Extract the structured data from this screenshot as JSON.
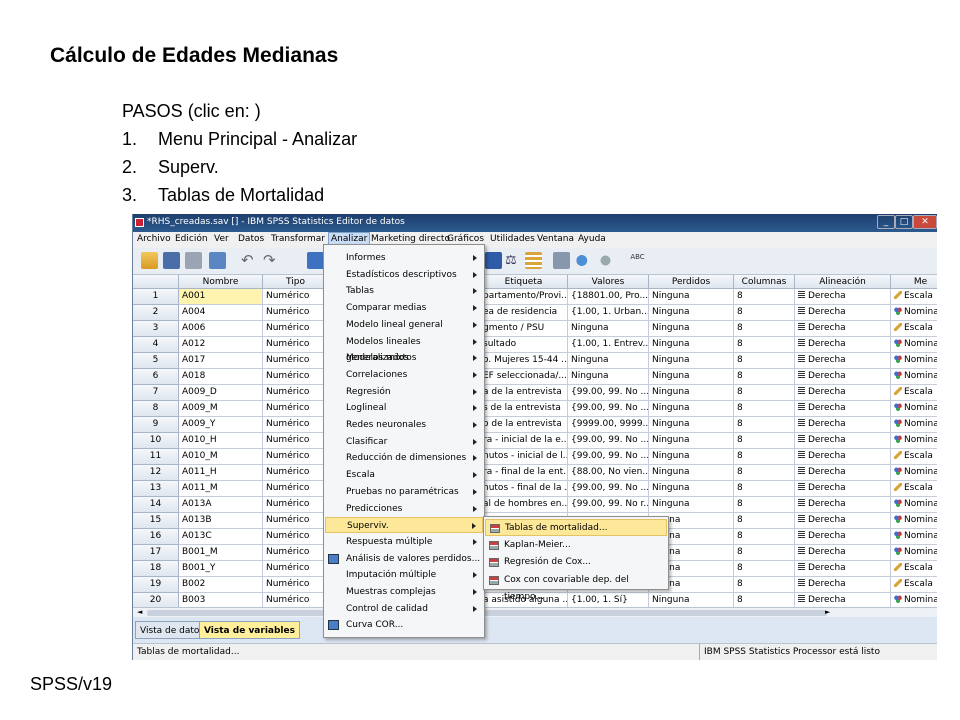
{
  "slide": {
    "title": "Cálculo de Edades Medianas",
    "steps_intro": "PASOS (clic en: )",
    "steps": [
      {
        "num": "1.",
        "text": "Menu Principal - Analizar"
      },
      {
        "num": "2.",
        "text": "Superv."
      },
      {
        "num": "3.",
        "text": "Tablas de Mortalidad"
      }
    ],
    "footer": "SPSS/v19"
  },
  "window": {
    "title": "*RHS_creadas.sav [] - IBM SPSS Statistics Editor de datos",
    "menubar": [
      "Archivo",
      "Edición",
      "Ver",
      "Datos",
      "Transformar",
      "Analizar",
      "Marketing directo",
      "Gráficos",
      "Utilidades",
      "Ventana",
      "Ayuda"
    ]
  },
  "grid": {
    "headers": [
      "Nombre",
      "Tipo",
      "Etiqueta",
      "Valores",
      "Perdidos",
      "Columnas",
      "Alineación",
      "Me"
    ],
    "rows": [
      {
        "n": "1",
        "nombre": "A001",
        "tipo": "Numérico",
        "etiqueta": "partamento/Provi...",
        "valores": "{18801.00, Pro...",
        "perdidos": "Ninguna",
        "columnas": "8",
        "alineacion": "Derecha",
        "medida": "Escala"
      },
      {
        "n": "2",
        "nombre": "A004",
        "tipo": "Numérico",
        "etiqueta": "ea de residencia",
        "valores": "{1.00, 1. Urban...",
        "perdidos": "Ninguna",
        "columnas": "8",
        "alineacion": "Derecha",
        "medida": "Nomina"
      },
      {
        "n": "3",
        "nombre": "A006",
        "tipo": "Numérico",
        "etiqueta": "gmento / PSU",
        "valores": "Ninguna",
        "perdidos": "Ninguna",
        "columnas": "8",
        "alineacion": "Derecha",
        "medida": "Escala"
      },
      {
        "n": "4",
        "nombre": "A012",
        "tipo": "Numérico",
        "etiqueta": "sultado",
        "valores": "{1.00, 1. Entrev...",
        "perdidos": "Ninguna",
        "columnas": "8",
        "alineacion": "Derecha",
        "medida": "Nomina"
      },
      {
        "n": "5",
        "nombre": "A017",
        "tipo": "Numérico",
        "etiqueta": "o. Mujeres 15-44 ...",
        "valores": "Ninguna",
        "perdidos": "Ninguna",
        "columnas": "8",
        "alineacion": "Derecha",
        "medida": "Nomina"
      },
      {
        "n": "6",
        "nombre": "A018",
        "tipo": "Numérico",
        "etiqueta": "EF seleccionada/...",
        "valores": "Ninguna",
        "perdidos": "Ninguna",
        "columnas": "8",
        "alineacion": "Derecha",
        "medida": "Nomina"
      },
      {
        "n": "7",
        "nombre": "A009_D",
        "tipo": "Numérico",
        "etiqueta": "a de la entrevista",
        "valores": "{99.00, 99. No ...",
        "perdidos": "Ninguna",
        "columnas": "8",
        "alineacion": "Derecha",
        "medida": "Escala"
      },
      {
        "n": "8",
        "nombre": "A009_M",
        "tipo": "Numérico",
        "etiqueta": "s de la entrevista",
        "valores": "{99.00, 99. No ...",
        "perdidos": "Ninguna",
        "columnas": "8",
        "alineacion": "Derecha",
        "medida": "Nomina"
      },
      {
        "n": "9",
        "nombre": "A009_Y",
        "tipo": "Numérico",
        "etiqueta": "o de la entrevista",
        "valores": "{9999.00, 9999....",
        "perdidos": "Ninguna",
        "columnas": "8",
        "alineacion": "Derecha",
        "medida": "Nomina"
      },
      {
        "n": "10",
        "nombre": "A010_H",
        "tipo": "Numérico",
        "etiqueta": "ra - inicial de la e...",
        "valores": "{99.00, 99. No ...",
        "perdidos": "Ninguna",
        "columnas": "8",
        "alineacion": "Derecha",
        "medida": "Nomina"
      },
      {
        "n": "11",
        "nombre": "A010_M",
        "tipo": "Numérico",
        "etiqueta": "nutos - inicial de l...",
        "valores": "{99.00, 99. No ...",
        "perdidos": "Ninguna",
        "columnas": "8",
        "alineacion": "Derecha",
        "medida": "Escala"
      },
      {
        "n": "12",
        "nombre": "A011_H",
        "tipo": "Numérico",
        "etiqueta": "ra - final de la ent...",
        "valores": "{88.00, No vien...",
        "perdidos": "Ninguna",
        "columnas": "8",
        "alineacion": "Derecha",
        "medida": "Nomina"
      },
      {
        "n": "13",
        "nombre": "A011_M",
        "tipo": "Numérico",
        "etiqueta": "nutos - final de la ...",
        "valores": "{99.00, 99. No ...",
        "perdidos": "Ninguna",
        "columnas": "8",
        "alineacion": "Derecha",
        "medida": "Escala"
      },
      {
        "n": "14",
        "nombre": "A013A",
        "tipo": "Numérico",
        "etiqueta": "al de hombres en...",
        "valores": "{99.00, 99. No r...",
        "perdidos": "Ninguna",
        "columnas": "8",
        "alineacion": "Derecha",
        "medida": "Nomina"
      },
      {
        "n": "15",
        "nombre": "A013B",
        "tipo": "Numérico",
        "etiqueta": "",
        "valores": "",
        "perdidos": "nguna",
        "columnas": "8",
        "alineacion": "Derecha",
        "medida": "Nomina"
      },
      {
        "n": "16",
        "nombre": "A013C",
        "tipo": "Numérico",
        "etiqueta": "",
        "valores": "",
        "perdidos": "nguna",
        "columnas": "8",
        "alineacion": "Derecha",
        "medida": "Nomina"
      },
      {
        "n": "17",
        "nombre": "B001_M",
        "tipo": "Numérico",
        "etiqueta": "",
        "valores": "",
        "perdidos": "nguna",
        "columnas": "8",
        "alineacion": "Derecha",
        "medida": "Nomina"
      },
      {
        "n": "18",
        "nombre": "B001_Y",
        "tipo": "Numérico",
        "etiqueta": "",
        "valores": "",
        "perdidos": "nguna",
        "columnas": "8",
        "alineacion": "Derecha",
        "medida": "Escala"
      },
      {
        "n": "19",
        "nombre": "B002",
        "tipo": "Numérico",
        "etiqueta": "",
        "valores": "",
        "perdidos": "nguna",
        "columnas": "8",
        "alineacion": "Derecha",
        "medida": "Escala"
      },
      {
        "n": "20",
        "nombre": "B003",
        "tipo": "Numérico",
        "etiqueta": "a asistido alguna ...",
        "valores": "{1.00, 1. Sí}",
        "perdidos": "Ninguna",
        "columnas": "8",
        "alineacion": "Derecha",
        "medida": "Nomina"
      }
    ]
  },
  "tabs": [
    "Vista de datos",
    "Vista de variables"
  ],
  "status": {
    "left": "Tablas de mortalidad...",
    "right": "IBM SPSS Statistics Processor está listo"
  },
  "analizar_menu": [
    {
      "label": "Informes",
      "sub": true
    },
    {
      "label": "Estadísticos descriptivos",
      "sub": true
    },
    {
      "label": "Tablas",
      "sub": true
    },
    {
      "label": "Comparar medias",
      "sub": true
    },
    {
      "label": "Modelo lineal general",
      "sub": true
    },
    {
      "label": "Modelos lineales generalizados",
      "sub": true
    },
    {
      "label": "Modelos mixtos",
      "sub": true
    },
    {
      "label": "Correlaciones",
      "sub": true
    },
    {
      "label": "Regresión",
      "sub": true
    },
    {
      "label": "Loglineal",
      "sub": true
    },
    {
      "label": "Redes neuronales",
      "sub": true
    },
    {
      "label": "Clasificar",
      "sub": true
    },
    {
      "label": "Reducción de dimensiones",
      "sub": true
    },
    {
      "label": "Escala",
      "sub": true
    },
    {
      "label": "Pruebas no paramétricas",
      "sub": true
    },
    {
      "label": "Predicciones",
      "sub": true
    },
    {
      "label": "Superviv.",
      "sub": true,
      "highlight": true
    },
    {
      "label": "Respuesta múltiple",
      "sub": true
    },
    {
      "label": "Análisis de valores perdidos...",
      "sub": false,
      "icon": "missing-values-icon"
    },
    {
      "label": "Imputación múltiple",
      "sub": true
    },
    {
      "label": "Muestras complejas",
      "sub": true
    },
    {
      "label": "Control de calidad",
      "sub": true
    },
    {
      "label": "Curva COR...",
      "sub": false,
      "icon": "roc-curve-icon"
    }
  ],
  "superviv_menu": [
    {
      "label": "Tablas de mortalidad...",
      "highlight": true
    },
    {
      "label": "Kaplan-Meier..."
    },
    {
      "label": "Regresión de Cox..."
    },
    {
      "label": "Cox con covariable dep. del tiempo..."
    }
  ]
}
